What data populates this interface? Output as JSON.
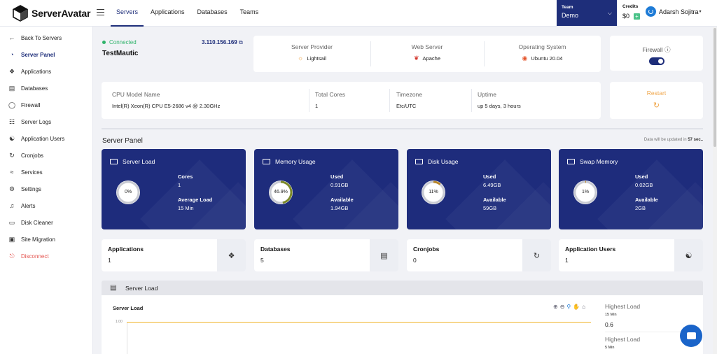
{
  "app": {
    "name": "ServerAvatar"
  },
  "nav": {
    "items": [
      {
        "label": "Servers"
      },
      {
        "label": "Applications"
      },
      {
        "label": "Databases"
      },
      {
        "label": "Teams"
      }
    ]
  },
  "team": {
    "label": "Team",
    "name": "Demo"
  },
  "credits": {
    "label": "Credits",
    "value": "$0",
    "add": "+"
  },
  "user": {
    "name": "Adarsh Sojitra"
  },
  "sidebar": {
    "items": [
      {
        "label": "Back To Servers",
        "icon": "arrow-left-icon"
      },
      {
        "label": "Server Panel",
        "icon": "dashboard-icon"
      },
      {
        "label": "Applications",
        "icon": "applications-icon"
      },
      {
        "label": "Databases",
        "icon": "database-icon"
      },
      {
        "label": "Firewall",
        "icon": "shield-icon"
      },
      {
        "label": "Server Logs",
        "icon": "logs-icon"
      },
      {
        "label": "Application Users",
        "icon": "users-icon"
      },
      {
        "label": "Cronjobs",
        "icon": "refresh-icon"
      },
      {
        "label": "Services",
        "icon": "services-icon"
      },
      {
        "label": "Settings",
        "icon": "gear-icon"
      },
      {
        "label": "Alerts",
        "icon": "bell-icon"
      },
      {
        "label": "Disk Cleaner",
        "icon": "disk-icon"
      },
      {
        "label": "Site Migration",
        "icon": "migration-icon"
      },
      {
        "label": "Disconnect",
        "icon": "disconnect-icon"
      }
    ]
  },
  "server": {
    "status": "Connected",
    "ip": "3.110.156.169",
    "name": "TestMautic",
    "provider_label": "Server Provider",
    "provider": "Lightsail",
    "webserver_label": "Web Server",
    "webserver": "Apache",
    "os_label": "Operating System",
    "os": "Ubuntu 20.04",
    "firewall_label": "Firewall",
    "firewall_on": true,
    "cpu_label": "CPU Model Name",
    "cpu": "Intel(R) Xeon(R) CPU E5-2686 v4 @ 2.30GHz",
    "cores_label": "Total Cores",
    "cores": "1",
    "tz_label": "Timezone",
    "tz": "Etc/UTC",
    "uptime_label": "Uptime",
    "uptime": "up 5 days, 3 hours",
    "restart_label": "Restart"
  },
  "panel": {
    "title": "Server Panel",
    "update_prefix": "Data will be updated in",
    "update_secs": "57 sec.."
  },
  "stats": [
    {
      "title": "Server Load",
      "pct_label": "0%",
      "pct": 0,
      "k1": "Cores",
      "v1": "1",
      "k2": "Average Load",
      "v2": "15 Min"
    },
    {
      "title": "Memory Usage",
      "pct_label": "46.9%",
      "pct": 46.9,
      "k1": "Used",
      "v1": "0.91GB",
      "k2": "Available",
      "v2": "1.94GB"
    },
    {
      "title": "Disk Usage",
      "pct_label": "11%",
      "pct": 11,
      "k1": "Used",
      "v1": "6.49GB",
      "k2": "Available",
      "v2": "59GB"
    },
    {
      "title": "Swap Memory",
      "pct_label": "1%",
      "pct": 1,
      "k1": "Used",
      "v1": "0.02GB",
      "k2": "Available",
      "v2": "2GB"
    }
  ],
  "counts": [
    {
      "title": "Applications",
      "value": "1",
      "icon": "applications-icon"
    },
    {
      "title": "Databases",
      "value": "5",
      "icon": "database-icon"
    },
    {
      "title": "Cronjobs",
      "value": "0",
      "icon": "refresh-icon"
    },
    {
      "title": "Application Users",
      "value": "1",
      "icon": "users-icon"
    }
  ],
  "load_section": {
    "title": "Server Load",
    "chart_title": "Server Load",
    "ytick": "1.00",
    "highest": [
      {
        "label": "Highest Load",
        "period": "15 Min",
        "value": "0.6"
      },
      {
        "label": "Highest Load",
        "period": "5 Min"
      }
    ]
  },
  "colors": {
    "primary": "#1e2e7a",
    "success": "#2fb36a",
    "warning": "#f0a64a",
    "danger": "#e4544f",
    "stat_bg": "#1e2c7c"
  }
}
